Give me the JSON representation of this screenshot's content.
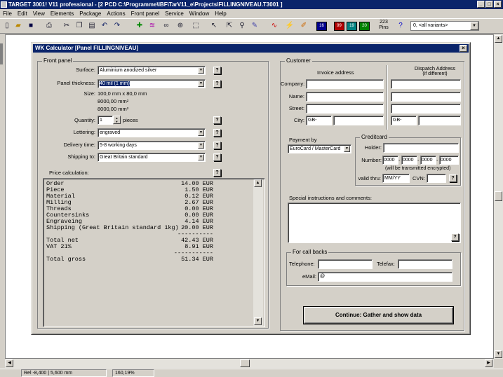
{
  "window": {
    "title": "TARGET 3001! V11 professional - [2 PCD C:\\Programme\\IBF\\TarV11_e\\Projects\\FILLINGNIVEAU.T3001 ]"
  },
  "menu": [
    "File",
    "Edit",
    "View",
    "Elements",
    "Package",
    "Actions",
    "Front panel",
    "Service",
    "Window",
    "Help"
  ],
  "toolbar": {
    "icons": [
      "new-document",
      "open-folder",
      "save",
      "print",
      "cut",
      "copy",
      "paste",
      "undo",
      "redo",
      "add-component",
      "layers",
      "binoculars",
      "zoom-in",
      "zoom-fit",
      "pointer",
      "select-cursor",
      "find",
      "measure",
      "bus",
      "wire",
      "route",
      "pen",
      "edit-tool",
      "color"
    ],
    "layer_buttons": [
      "16",
      "99",
      "19",
      "20"
    ],
    "pins_count": "223",
    "pins_label": "Pins",
    "help_icon": "help",
    "variant_value": "0, <all variants>"
  },
  "dialog": {
    "title": "WK Calculator  [Panel  FILLINGNIVEAU]",
    "front_panel": {
      "group_label": "Front panel",
      "surface_label": "Surface:",
      "surface_value": "Aluminium anodized silver",
      "thickness_label": "Panel thickness:",
      "thickness_value": "40 mil (1 mm)",
      "size_label": "Size:",
      "size_lines": [
        "100,0 mm x 80,0 mm",
        "8000,00 mm²",
        "8000,00 mm²"
      ],
      "quantity_label": "Quantity:",
      "quantity_value": "1",
      "quantity_unit": "pieces",
      "lettering_label": "Lettering:",
      "lettering_value": "engraved",
      "delivery_label": "Delivery time:",
      "delivery_value": "5-8 working days",
      "shipping_label": "Shipping to:",
      "shipping_value": "Great Britain standard",
      "help_label": "?"
    },
    "price": {
      "label": "Price calculation:",
      "rows": [
        {
          "name": "Order",
          "value": "14.00 EUR"
        },
        {
          "name": "Piece",
          "value": "1.50 EUR"
        },
        {
          "name": "Material",
          "value": "0.12 EUR"
        },
        {
          "name": "Milling",
          "value": "2.67 EUR"
        },
        {
          "name": "Threads",
          "value": "0.00 EUR"
        },
        {
          "name": "Countersinks",
          "value": "0.00 EUR"
        },
        {
          "name": "Engraveing",
          "value": "4.14 EUR"
        },
        {
          "name": "Shipping (Great Britain standard 1kg)",
          "value": "20.00 EUR"
        }
      ],
      "sep1": "----------",
      "total_net": {
        "name": "Total net",
        "value": "42.43 EUR"
      },
      "vat": {
        "name": "VAT 21%",
        "value": "8.91 EUR"
      },
      "sep2": "-----------",
      "total_gross": {
        "name": "Total gross",
        "value": "51.34 EUR"
      }
    },
    "customer": {
      "group_label": "Customer",
      "invoice_header": "Invoice address",
      "dispatch_header": "Dispatch Address",
      "dispatch_sub": "(if different)",
      "company_label": "Company:",
      "name_label": "Name:",
      "street_label": "Street:",
      "city_label": "City:",
      "city_prefix": "GB-",
      "dispatch_city_prefix": "GB-"
    },
    "payment": {
      "label": "Payment by",
      "value": "EuroCard / MasterCard",
      "creditcard_label": "Creditcard",
      "holder_label": "Holder:",
      "number_label": "Number:",
      "number_parts": [
        "0000",
        "0000",
        "0000",
        "0000"
      ],
      "dash": "-",
      "encrypted_note": "(will be transmitted encrypted)",
      "valid_label": "valid thru:",
      "valid_value": "MM/YY",
      "cvn_label": "CVN:"
    },
    "special": {
      "label": "Special instructions and comments:"
    },
    "callbacks": {
      "label": "For call backs",
      "telephone_label": "Telephone:",
      "telefax_label": "Telefax:",
      "email_label": "eMail:",
      "email_value": "@"
    },
    "continue_label": "Continue: Gather and show data"
  },
  "status": {
    "rel": "Rel -8,400 | 5,600 mm",
    "zoom": "160,19%"
  }
}
